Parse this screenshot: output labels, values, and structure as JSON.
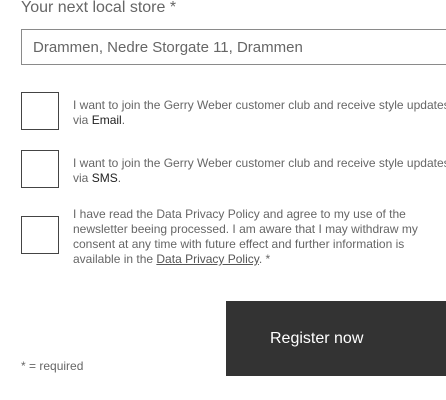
{
  "store": {
    "label": "Your next local store *",
    "value": "Drammen, Nedre Storgate 11, Drammen"
  },
  "consents": [
    {
      "text_before": "I want to join the Gerry Weber customer club and receive style updates",
      "text_via": "via ",
      "channel": "Email",
      "text_after": ".",
      "checked": false
    },
    {
      "text_before": "I want to join the Gerry Weber customer club and receive style updates",
      "text_via": "via ",
      "channel": "SMS",
      "text_after": ".",
      "checked": false
    },
    {
      "lines": [
        "I have read the Data Privacy Policy and agree to my use of the",
        "newsletter beeing processed. I am aware that I may withdraw my",
        "consent at any time with future effect and further information is"
      ],
      "last_prefix": "available in the ",
      "link_label": "Data Privacy Policy",
      "suffix": ". *",
      "checked": false
    }
  ],
  "register": {
    "label": "Register now"
  },
  "required_note": "* = required"
}
